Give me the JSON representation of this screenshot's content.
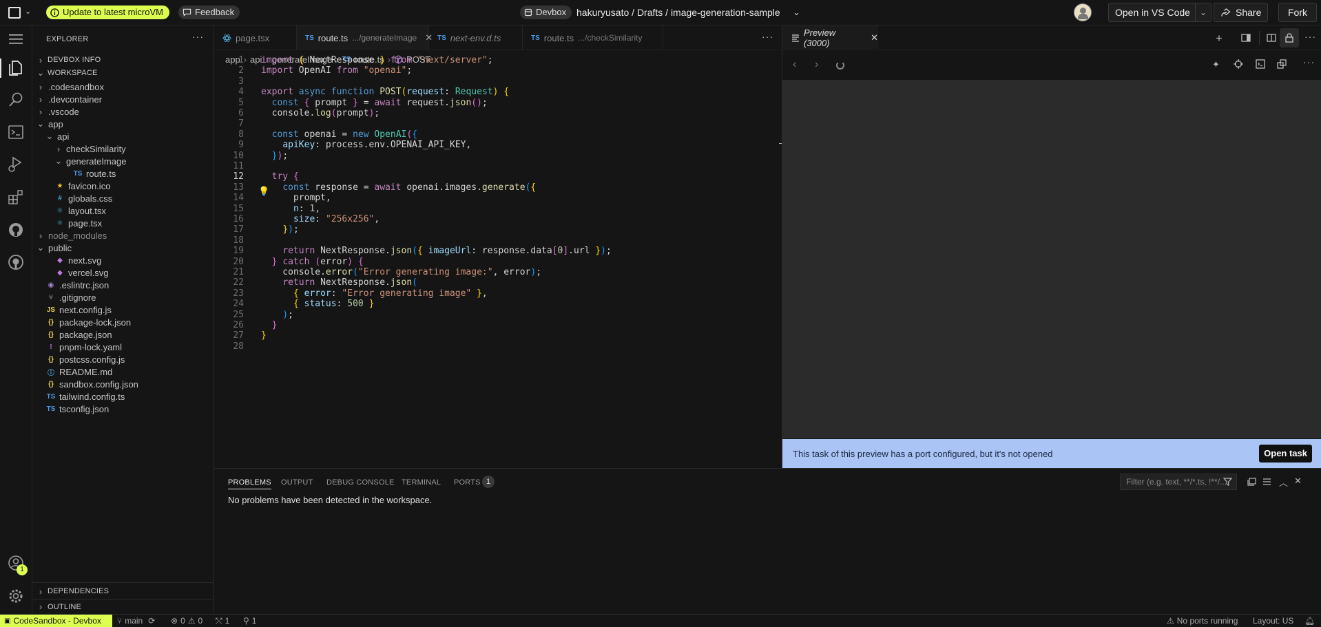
{
  "topbar": {
    "update_label": "Update to latest microVM",
    "feedback_label": "Feedback",
    "devbox_label": "Devbox",
    "path": "hakuryusato / Drafts / image-generation-sample",
    "open_vscode_label": "Open in VS Code",
    "share_label": "Share",
    "fork_label": "Fork"
  },
  "sidebar": {
    "title": "EXPLORER",
    "devbox_info": "DEVBOX INFO",
    "workspace": "WORKSPACE",
    "tree": [
      {
        "label": ".codesandbox",
        "depth": 0,
        "type": "folder",
        "open": false
      },
      {
        "label": ".devcontainer",
        "depth": 0,
        "type": "folder",
        "open": false
      },
      {
        "label": ".vscode",
        "depth": 0,
        "type": "folder",
        "open": false
      },
      {
        "label": "app",
        "depth": 0,
        "type": "folder",
        "open": true
      },
      {
        "label": "api",
        "depth": 1,
        "type": "folder",
        "open": true
      },
      {
        "label": "checkSimilarity",
        "depth": 2,
        "type": "folder",
        "open": false
      },
      {
        "label": "generateImage",
        "depth": 2,
        "type": "folder",
        "open": true
      },
      {
        "label": "route.ts",
        "depth": 3,
        "type": "ts"
      },
      {
        "label": "favicon.ico",
        "depth": 1,
        "type": "star"
      },
      {
        "label": "globals.css",
        "depth": 1,
        "type": "css"
      },
      {
        "label": "layout.tsx",
        "depth": 1,
        "type": "react"
      },
      {
        "label": "page.tsx",
        "depth": 1,
        "type": "react"
      },
      {
        "label": "node_modules",
        "depth": 0,
        "type": "folder",
        "open": false,
        "dim": true
      },
      {
        "label": "public",
        "depth": 0,
        "type": "folder",
        "open": true
      },
      {
        "label": "next.svg",
        "depth": 1,
        "type": "svg"
      },
      {
        "label": "vercel.svg",
        "depth": 1,
        "type": "svg"
      },
      {
        "label": ".eslintrc.json",
        "depth": 0,
        "type": "eslint"
      },
      {
        "label": ".gitignore",
        "depth": 0,
        "type": "git"
      },
      {
        "label": "next.config.js",
        "depth": 0,
        "type": "js"
      },
      {
        "label": "package-lock.json",
        "depth": 0,
        "type": "json"
      },
      {
        "label": "package.json",
        "depth": 0,
        "type": "json"
      },
      {
        "label": "pnpm-lock.yaml",
        "depth": 0,
        "type": "yaml"
      },
      {
        "label": "postcss.config.js",
        "depth": 0,
        "type": "json"
      },
      {
        "label": "README.md",
        "depth": 0,
        "type": "info"
      },
      {
        "label": "sandbox.config.json",
        "depth": 0,
        "type": "json"
      },
      {
        "label": "tailwind.config.ts",
        "depth": 0,
        "type": "ts"
      },
      {
        "label": "tsconfig.json",
        "depth": 0,
        "type": "tsjson"
      }
    ],
    "dependencies": "DEPENDENCIES",
    "outline": "OUTLINE"
  },
  "editor": {
    "tabs": [
      {
        "label": "page.tsx",
        "detail": "",
        "active": false,
        "italic": false
      },
      {
        "label": "route.ts",
        "detail": ".../generateImage",
        "active": true,
        "italic": false
      },
      {
        "label": "next-env.d.ts",
        "detail": "",
        "active": false,
        "italic": true
      },
      {
        "label": "route.ts",
        "detail": ".../checkSimilarity",
        "active": false,
        "italic": false
      }
    ],
    "breadcrumb": [
      "app",
      "api",
      "generateImage",
      "route.ts",
      "POST"
    ],
    "current_line": 12,
    "code": [
      [
        [
          "k",
          "import"
        ],
        [
          "p",
          " "
        ],
        [
          "br1",
          "{"
        ],
        [
          "p",
          " NextResponse "
        ],
        [
          "br1",
          "}"
        ],
        [
          "p",
          " "
        ],
        [
          "k",
          "from"
        ],
        [
          "p",
          " "
        ],
        [
          "s",
          "\"next/server\""
        ],
        [
          "p",
          ";"
        ]
      ],
      [
        [
          "k",
          "import"
        ],
        [
          "p",
          " OpenAI "
        ],
        [
          "k",
          "from"
        ],
        [
          "p",
          " "
        ],
        [
          "s",
          "\"openai\""
        ],
        [
          "p",
          ";"
        ]
      ],
      [],
      [
        [
          "k",
          "export"
        ],
        [
          "p",
          " "
        ],
        [
          "kb",
          "async"
        ],
        [
          "p",
          " "
        ],
        [
          "kb",
          "function"
        ],
        [
          "p",
          " "
        ],
        [
          "f",
          "POST"
        ],
        [
          "br1",
          "("
        ],
        [
          "v",
          "request"
        ],
        [
          "p",
          ": "
        ],
        [
          "c",
          "Request"
        ],
        [
          "br1",
          ")"
        ],
        [
          "p",
          " "
        ],
        [
          "br1",
          "{"
        ]
      ],
      [
        [
          "p",
          "  "
        ],
        [
          "kb",
          "const"
        ],
        [
          "p",
          " "
        ],
        [
          "br2",
          "{"
        ],
        [
          "p",
          " prompt "
        ],
        [
          "br2",
          "}"
        ],
        [
          "p",
          " = "
        ],
        [
          "k",
          "await"
        ],
        [
          "p",
          " request."
        ],
        [
          "f",
          "json"
        ],
        [
          "br2",
          "()"
        ],
        [
          "p",
          ";"
        ]
      ],
      [
        [
          "p",
          "  console."
        ],
        [
          "f",
          "log"
        ],
        [
          "br2",
          "("
        ],
        [
          "p",
          "prompt"
        ],
        [
          "br2",
          ")"
        ],
        [
          "p",
          ";"
        ]
      ],
      [],
      [
        [
          "p",
          "  "
        ],
        [
          "kb",
          "const"
        ],
        [
          "p",
          " openai = "
        ],
        [
          "kb",
          "new"
        ],
        [
          "p",
          " "
        ],
        [
          "c",
          "OpenAI"
        ],
        [
          "br2",
          "("
        ],
        [
          "br3",
          "{"
        ]
      ],
      [
        [
          "p",
          "    "
        ],
        [
          "v",
          "apiKey"
        ],
        [
          "p",
          ": process.env.OPENAI_API_KEY,"
        ]
      ],
      [
        [
          "p",
          "  "
        ],
        [
          "br3",
          "}"
        ],
        [
          "br2",
          ")"
        ],
        [
          "p",
          ";"
        ]
      ],
      [],
      [
        [
          "p",
          "  "
        ],
        [
          "k",
          "try"
        ],
        [
          "p",
          " "
        ],
        [
          "br2",
          "{"
        ]
      ],
      [
        [
          "p",
          "    "
        ],
        [
          "kb",
          "const"
        ],
        [
          "p",
          " response = "
        ],
        [
          "k",
          "await"
        ],
        [
          "p",
          " openai.images."
        ],
        [
          "f",
          "generate"
        ],
        [
          "br3",
          "("
        ],
        [
          "br1",
          "{"
        ]
      ],
      [
        [
          "p",
          "      prompt,"
        ]
      ],
      [
        [
          "p",
          "      "
        ],
        [
          "v",
          "n"
        ],
        [
          "p",
          ": "
        ],
        [
          "n",
          "1"
        ],
        [
          "p",
          ","
        ]
      ],
      [
        [
          "p",
          "      "
        ],
        [
          "v",
          "size"
        ],
        [
          "p",
          ": "
        ],
        [
          "s",
          "\"256x256\""
        ],
        [
          "p",
          ","
        ]
      ],
      [
        [
          "p",
          "    "
        ],
        [
          "br1",
          "}"
        ],
        [
          "br3",
          ")"
        ],
        [
          "p",
          ";"
        ]
      ],
      [],
      [
        [
          "p",
          "    "
        ],
        [
          "k",
          "return"
        ],
        [
          "p",
          " NextResponse."
        ],
        [
          "f",
          "json"
        ],
        [
          "br3",
          "("
        ],
        [
          "br1",
          "{"
        ],
        [
          "p",
          " "
        ],
        [
          "v",
          "imageUrl"
        ],
        [
          "p",
          ": response.data"
        ],
        [
          "br2",
          "["
        ],
        [
          "n",
          "0"
        ],
        [
          "br2",
          "]"
        ],
        [
          "p",
          ".url "
        ],
        [
          "br1",
          "}"
        ],
        [
          "br3",
          ")"
        ],
        [
          "p",
          ";"
        ]
      ],
      [
        [
          "p",
          "  "
        ],
        [
          "br2",
          "}"
        ],
        [
          "p",
          " "
        ],
        [
          "k",
          "catch"
        ],
        [
          "p",
          " "
        ],
        [
          "br2",
          "("
        ],
        [
          "p",
          "error"
        ],
        [
          "br2",
          ")"
        ],
        [
          "p",
          " "
        ],
        [
          "br2",
          "{"
        ]
      ],
      [
        [
          "p",
          "    console."
        ],
        [
          "f",
          "error"
        ],
        [
          "br3",
          "("
        ],
        [
          "s",
          "\"Error generating image:\""
        ],
        [
          "p",
          ", error"
        ],
        [
          "br3",
          ")"
        ],
        [
          "p",
          ";"
        ]
      ],
      [
        [
          "p",
          "    "
        ],
        [
          "k",
          "return"
        ],
        [
          "p",
          " NextResponse."
        ],
        [
          "f",
          "json"
        ],
        [
          "br3",
          "("
        ]
      ],
      [
        [
          "p",
          "      "
        ],
        [
          "br1",
          "{"
        ],
        [
          "p",
          " "
        ],
        [
          "v",
          "error"
        ],
        [
          "p",
          ": "
        ],
        [
          "s",
          "\"Error generating image\""
        ],
        [
          "p",
          " "
        ],
        [
          "br1",
          "}"
        ],
        [
          "p",
          ","
        ]
      ],
      [
        [
          "p",
          "      "
        ],
        [
          "br1",
          "{"
        ],
        [
          "p",
          " "
        ],
        [
          "v",
          "status"
        ],
        [
          "p",
          ": "
        ],
        [
          "n",
          "500"
        ],
        [
          "p",
          " "
        ],
        [
          "br1",
          "}"
        ]
      ],
      [
        [
          "p",
          "    "
        ],
        [
          "br3",
          ")"
        ],
        [
          "p",
          ";"
        ]
      ],
      [
        [
          "p",
          "  "
        ],
        [
          "br2",
          "}"
        ]
      ],
      [
        [
          "br1",
          "}"
        ]
      ],
      []
    ]
  },
  "preview": {
    "tab_label": "Preview (3000)",
    "banner_text": "This task of this preview has a port configured, but it's not opened",
    "open_task_label": "Open task"
  },
  "panel": {
    "tabs": [
      "PROBLEMS",
      "OUTPUT",
      "DEBUG CONSOLE",
      "TERMINAL",
      "PORTS"
    ],
    "ports_badge": "1",
    "filter_placeholder": "Filter (e.g. text, **/*.ts, !**/...",
    "message": "No problems have been detected in the workspace."
  },
  "account_badge": "1",
  "statusbar": {
    "remote": "CodeSandbox - Devbox",
    "branch": "main",
    "errors": "0",
    "warnings": "0",
    "ports_fwd": "1",
    "signal": "1",
    "no_ports": "No ports running",
    "layout": "Layout: US"
  },
  "colors": {
    "accent_green": "#dcff50",
    "banner_blue": "#a9c4f5",
    "background": "#151515"
  }
}
